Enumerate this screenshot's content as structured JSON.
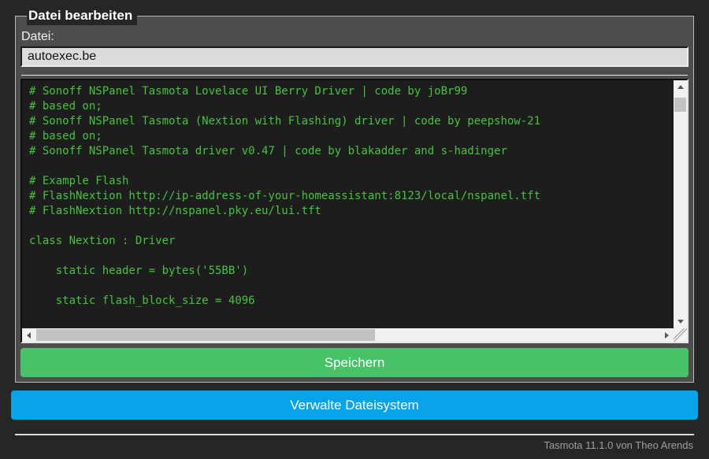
{
  "colors": {
    "page_background": "#262626",
    "panel_background": "#4d4d4d",
    "editor_background": "#1d1d1d",
    "editor_text": "#46c33e",
    "save_button": "#46c268",
    "manage_button": "#08a3e9"
  },
  "editor_panel": {
    "legend": "Datei bearbeiten",
    "file_field": {
      "label": "Datei:",
      "value": "autoexec.be"
    },
    "code_editor": {
      "lines": [
        "# Sonoff NSPanel Tasmota Lovelace UI Berry Driver | code by joBr99",
        "# based on;",
        "# Sonoff NSPanel Tasmota (Nextion with Flashing) driver | code by peepshow-21",
        "# based on;",
        "# Sonoff NSPanel Tasmota driver v0.47 | code by blakadder and s-hadinger",
        "",
        "# Example Flash",
        "# FlashNextion http://ip-address-of-your-homeassistant:8123/local/nspanel.tft",
        "# FlashNextion http://nspanel.pky.eu/lui.tft",
        "",
        "class Nextion : Driver",
        "",
        "    static header = bytes('55BB')",
        "",
        "    static flash_block_size = 4096",
        ""
      ]
    },
    "save_button_label": "Speichern"
  },
  "manage_button_label": "Verwalte Dateisystem",
  "footer": {
    "version_text": "Tasmota 11.1.0 von Theo Arends"
  }
}
